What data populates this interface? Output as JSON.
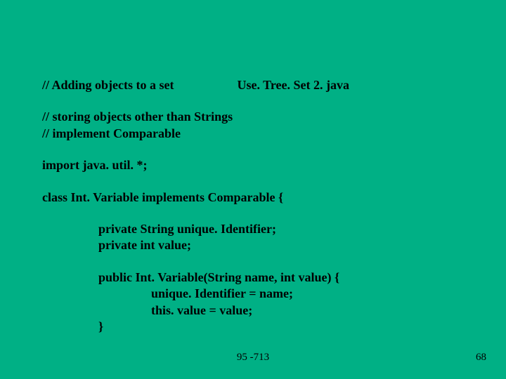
{
  "lines": {
    "l1a": "// Adding objects to a set",
    "l1b": "Use. Tree. Set 2. java",
    "l2": "// storing objects other than Strings",
    "l3": "// implement Comparable",
    "l4": "import java. util. *;",
    "l5": "class Int. Variable implements Comparable {",
    "l6": "private String unique. Identifier;",
    "l7": "private int value;",
    "l8": "public Int. Variable(String name, int value) {",
    "l9": "unique. Identifier = name;",
    "l10": "this. value = value;",
    "l11": "}"
  },
  "footer": {
    "center": "95 -713",
    "page": "68"
  }
}
